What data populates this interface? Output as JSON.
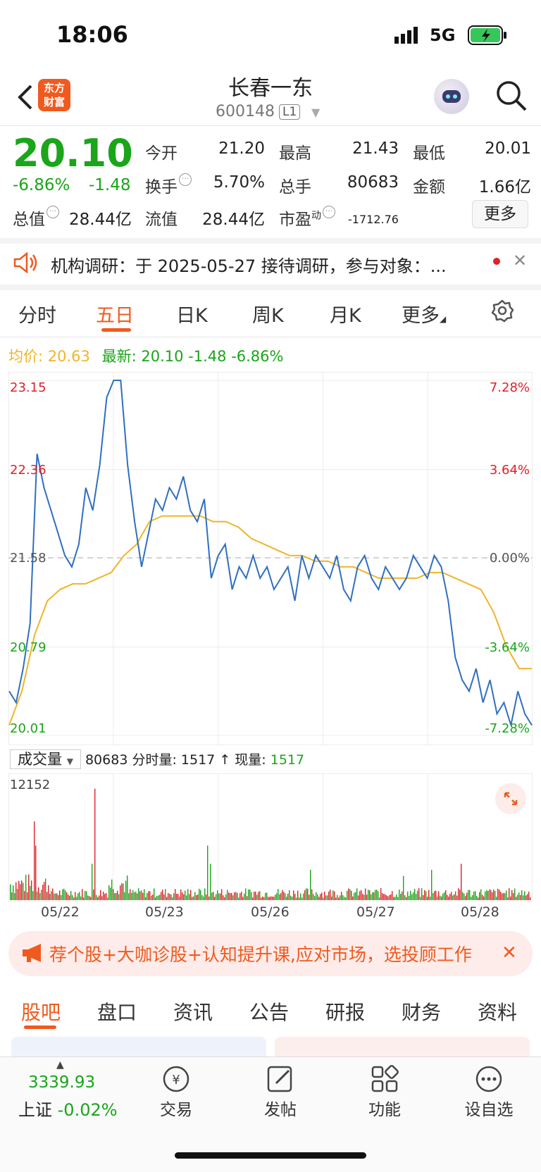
{
  "status_bar": {
    "time": "18:06",
    "network": "5G"
  },
  "header": {
    "logo_line1": "东方",
    "logo_line2": "财富",
    "stock_name": "长春一东",
    "stock_code": "600148",
    "level": "L1"
  },
  "quote": {
    "price": "20.10",
    "change_pct": "-6.86%",
    "change_amt": "-1.48",
    "open_label": "今开",
    "open_value": "21.20",
    "high_label": "最高",
    "high_value": "21.43",
    "low_label": "最低",
    "low_value": "20.01",
    "turnover_label": "换手",
    "turnover_value": "5.70%",
    "volume_label": "总手",
    "volume_value": "80683",
    "amount_label": "金额",
    "amount_value": "1.66亿",
    "mktcap_label": "总值",
    "mktcap_value": "28.44亿",
    "float_label": "流值",
    "float_value": "28.44亿",
    "pe_label": "市盈",
    "pe_sup": "动",
    "pe_value": "-1712.76",
    "more_label": "更多"
  },
  "notice": {
    "text": "机构调研：于 2025-05-27 接待调研，参与对象：..."
  },
  "chart_tabs": [
    "分时",
    "五日",
    "日K",
    "周K",
    "月K",
    "更多"
  ],
  "active_chart_tab": "五日",
  "chart_header": {
    "avg_label": "均价:",
    "avg_value": "20.63",
    "latest_label": "最新:",
    "latest_value": "20.10",
    "latest_change": "-1.48",
    "latest_pct": "-6.86%"
  },
  "chart_data": {
    "type": "line",
    "price_axis_left": [
      "23.15",
      "22.36",
      "21.58",
      "20.79",
      "20.01"
    ],
    "price_axis_right": [
      "7.28%",
      "3.64%",
      "0.00%",
      "-3.64%",
      "-7.28%"
    ],
    "ylim": [
      20.01,
      23.15
    ],
    "prev_close": 21.58,
    "x": [
      "05/22",
      "05/23",
      "05/26",
      "05/27",
      "05/28"
    ],
    "series": [
      {
        "name": "最新",
        "color": "#2f6fc1",
        "values": [
          20.4,
          20.3,
          20.6,
          21.0,
          22.5,
          22.2,
          22.0,
          21.8,
          21.6,
          21.5,
          21.7,
          22.2,
          22.0,
          22.4,
          23.0,
          23.15,
          23.15,
          22.4,
          21.9,
          21.5,
          21.8,
          22.1,
          22.0,
          22.2,
          22.1,
          22.3,
          22.0,
          21.9,
          22.1,
          21.4,
          21.6,
          21.7,
          21.3,
          21.5,
          21.4,
          21.6,
          21.4,
          21.5,
          21.3,
          21.4,
          21.5,
          21.2,
          21.6,
          21.4,
          21.6,
          21.5,
          21.4,
          21.6,
          21.3,
          21.2,
          21.5,
          21.6,
          21.4,
          21.3,
          21.5,
          21.4,
          21.3,
          21.4,
          21.6,
          21.5,
          21.4,
          21.6,
          21.5,
          21.2,
          20.7,
          20.5,
          20.4,
          20.6,
          20.3,
          20.5,
          20.2,
          20.3,
          20.1,
          20.4,
          20.2,
          20.1
        ]
      },
      {
        "name": "均价",
        "color": "#f0b429",
        "values": [
          20.1,
          20.4,
          20.9,
          21.2,
          21.3,
          21.35,
          21.35,
          21.4,
          21.45,
          21.6,
          21.7,
          21.9,
          21.95,
          21.95,
          21.95,
          21.95,
          21.9,
          21.9,
          21.85,
          21.75,
          21.7,
          21.65,
          21.6,
          21.6,
          21.55,
          21.55,
          21.5,
          21.5,
          21.45,
          21.4,
          21.4,
          21.4,
          21.4,
          21.45,
          21.45,
          21.4,
          21.35,
          21.3,
          21.1,
          20.8,
          20.6,
          20.6
        ]
      }
    ]
  },
  "volume": {
    "selector_label": "成交量",
    "total": "80683",
    "tick_label": "分时量:",
    "tick_value": "1517",
    "arrow": "↑",
    "now_label": "现量:",
    "now_value": "1517",
    "max_label": "12152"
  },
  "promo": {
    "text": "荐个股+大咖诊股+认知提升课,应对市场，选投顾工作"
  },
  "bottom_tabs": [
    "股吧",
    "盘口",
    "资讯",
    "公告",
    "研报",
    "财务",
    "资料"
  ],
  "index": {
    "value": "3339.93",
    "name": "上证",
    "change": "-0.02%"
  },
  "nav": [
    "交易",
    "发帖",
    "功能",
    "设自选"
  ],
  "colors": {
    "up": "#e0202a",
    "down": "#1aa51a",
    "accent": "#f05a1e",
    "line": "#2f6fc1",
    "avg": "#f0b429"
  }
}
